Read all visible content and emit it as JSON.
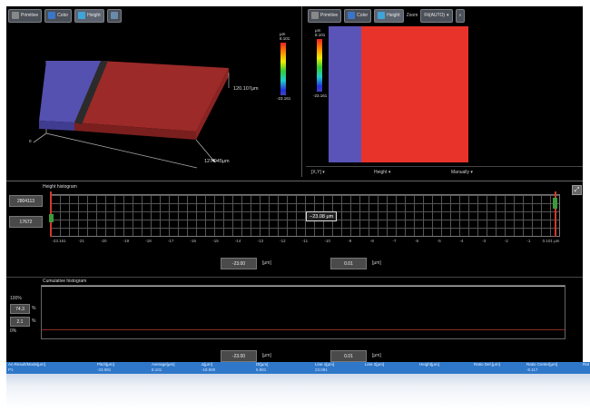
{
  "toolbar_3d": {
    "btn1": "Primitive",
    "btn2": "Color",
    "btn3": "Height"
  },
  "toolbar_2d": {
    "btn1": "Primitive",
    "btn2": "Color",
    "btn3": "Height",
    "zoom_label": "Zoom",
    "zoom_value": "Fit(AUTO)"
  },
  "scale_3d": {
    "unit": "μm",
    "max": "8.101",
    "min": "-23.161"
  },
  "scale_2d": {
    "unit": "μm",
    "max": "8.101",
    "min": "-23.161"
  },
  "axis_3d": {
    "y_label": "120.107μm",
    "x_label": "127.945μm",
    "z_label": "0"
  },
  "view2d_footer": {
    "view_select": "[X,Y]",
    "mode_select": "Height",
    "display_select": "Manually"
  },
  "height_hist": {
    "title": "Height histogram",
    "side_top": "2804113",
    "side_bottom": "17672",
    "cursor_label": "−23.08 μm",
    "ticks": [
      "-23.161",
      "-21",
      "-20",
      "-19",
      "-18",
      "-17",
      "-16",
      "-15",
      "-14",
      "-13",
      "-12",
      "-11",
      "-10",
      "-9",
      "-8",
      "-7",
      "-6",
      "-5",
      "-4",
      "-3",
      "-2",
      "-1",
      "0.101 μm"
    ],
    "value_left": "-23.00",
    "value_right": "0.01",
    "unit": "[μm]"
  },
  "cum_hist": {
    "title": "Cumulative histogram",
    "y_top": "100%",
    "y_bottom": "0%",
    "box_upper": "74.3",
    "box_lower": "2.1",
    "pct": "%",
    "value_left": "-23.00",
    "value_right": "0.01",
    "unit": "[μm]"
  },
  "results": {
    "headers": [
      "An.Result/Mode[μm]",
      "Pitch[μm]",
      "Average[μm]",
      "Δ[μm]",
      "Dt[μm]",
      "Line 1[μm]",
      "Line 2[μm]",
      "Height[μm]",
      "Ratio Def.[μm]",
      "Ratio Center[μm]",
      "Rat"
    ],
    "row": [
      "P1",
      "-23.081",
      "8.101",
      "-18.890",
      "5.881",
      "23.081",
      "",
      "",
      "",
      "-5.117",
      ""
    ]
  },
  "colors": {
    "red": "#c9302c",
    "purple": "#5a54b8",
    "accent": "#2f78c9"
  }
}
